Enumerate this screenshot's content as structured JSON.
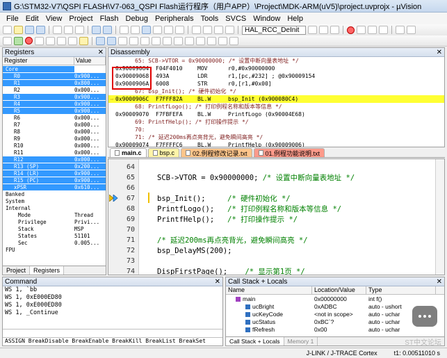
{
  "window": {
    "title": "G:\\STM32-V7\\QSPI FLASH\\V7-063_QSPI Flash运行程序（用户APP）\\Project\\MDK-ARM(uV5)\\project.uvprojx - µVision"
  },
  "menu": [
    "File",
    "Edit",
    "View",
    "Project",
    "Flash",
    "Debug",
    "Peripherals",
    "Tools",
    "SVCS",
    "Window",
    "Help"
  ],
  "toolbar": {
    "target_combo": "HAL_RCC_DeInit"
  },
  "registers": {
    "title": "Registers",
    "headers": [
      "Register",
      "Value"
    ],
    "rows": [
      {
        "name": "Core",
        "value": "",
        "sel": true
      },
      {
        "name": "R0",
        "value": "0x900...",
        "sel": true
      },
      {
        "name": "R1",
        "value": "0x800...",
        "sel": true
      },
      {
        "name": "R2",
        "value": "0x000...",
        "sel": false
      },
      {
        "name": "R3",
        "value": "0x900...",
        "sel": true
      },
      {
        "name": "R4",
        "value": "0x900...",
        "sel": true
      },
      {
        "name": "R5",
        "value": "0x900...",
        "sel": true
      },
      {
        "name": "R6",
        "value": "0x000...",
        "sel": false
      },
      {
        "name": "R7",
        "value": "0x000...",
        "sel": false
      },
      {
        "name": "R8",
        "value": "0x000...",
        "sel": false
      },
      {
        "name": "R9",
        "value": "0x000...",
        "sel": false
      },
      {
        "name": "R10",
        "value": "0x000...",
        "sel": false
      },
      {
        "name": "R11",
        "value": "0x000...",
        "sel": false
      },
      {
        "name": "R12",
        "value": "0x000...",
        "sel": true
      },
      {
        "name": "R13 (SP)",
        "value": "0x200...",
        "sel": true
      },
      {
        "name": "R14 (LR)",
        "value": "0x900...",
        "sel": true
      },
      {
        "name": "R15 (PC)",
        "value": "0x900...",
        "sel": true
      },
      {
        "name": "xPSR",
        "value": "0x610...",
        "sel": true
      },
      {
        "name": "Banked",
        "value": "",
        "sel": false
      },
      {
        "name": "System",
        "value": "",
        "sel": false
      },
      {
        "name": "Internal",
        "value": "",
        "sel": false
      },
      {
        "name": "Mode",
        "value": "Thread",
        "sel": false
      },
      {
        "name": "Privilege",
        "value": "Privi...",
        "sel": false
      },
      {
        "name": "Stack",
        "value": "MSP",
        "sel": false
      },
      {
        "name": "States",
        "value": "51101",
        "sel": false
      },
      {
        "name": "Sec",
        "value": "0.005...",
        "sel": false
      },
      {
        "name": "FPU",
        "value": "",
        "sel": false
      }
    ],
    "tabs": [
      "Project",
      "Registers"
    ]
  },
  "disassembly": {
    "title": "Disassembly",
    "lines": [
      {
        "kind": "src",
        "text": "65:          SCB->VTOR = 0x90000000;  /* 设置中断向量表地址 */"
      },
      {
        "kind": "asm",
        "addr": "0x90009064",
        "code": "F04F4010",
        "op": "MOV",
        "args": "r0,#0x90000000"
      },
      {
        "kind": "asm",
        "addr": "0x90009068",
        "code": "493A",
        "op": "LDR",
        "args": "r1,[pc,#232]  ; @0x90009154"
      },
      {
        "kind": "asm",
        "addr": "0x9000906A",
        "code": "6008",
        "op": "STR",
        "args": "r0,[r1,#0x00]"
      },
      {
        "kind": "src",
        "text": "67:      bsp_Init();          /* 硬件初始化 */"
      },
      {
        "kind": "cur",
        "addr": "0x9000906C",
        "code": "F7FFF82A",
        "op": "BL.W",
        "args": "bsp_Init (0x900080C4)"
      },
      {
        "kind": "src",
        "text": "68:      PrintfLogo();    /* 打印例程名称和版本等信息 */"
      },
      {
        "kind": "asm",
        "addr": "0x90009070",
        "code": "F7FBFEFA",
        "op": "BL.W",
        "args": "PrintfLogo (0x90004E68)"
      },
      {
        "kind": "src",
        "text": "69:      PrintfHelp();    /* 打印操作提示 */"
      },
      {
        "kind": "src",
        "text": "70:"
      },
      {
        "kind": "src",
        "text": "71:      /* 延迟200ms再点亮背光，避免瞬间高亮 */"
      },
      {
        "kind": "asm",
        "addr": "0x90009074",
        "code": "F7FFFFC6",
        "op": "BL.W",
        "args": "PrintfHelp (0x90009006)"
      }
    ]
  },
  "editor_tabs": [
    "main.c",
    "bsp.c",
    "02.例程修改记录.txt",
    "01.例程功能说明.txt"
  ],
  "editor": {
    "lines": [
      {
        "n": "64",
        "code": "",
        "comment": ""
      },
      {
        "n": "65",
        "code": "SCB->VTOR = 0x90000000; ",
        "comment": "/* 设置中断向量表地址 */"
      },
      {
        "n": "66",
        "code": "",
        "comment": ""
      },
      {
        "n": "67",
        "code": "bsp_Init();     ",
        "comment": "/* 硬件初始化 */"
      },
      {
        "n": "68",
        "code": "PrintfLogo();   ",
        "comment": "/* 打印例程名称和版本等信息 */"
      },
      {
        "n": "69",
        "code": "PrintfHelp();   ",
        "comment": "/* 打印操作提示 */"
      },
      {
        "n": "70",
        "code": "",
        "comment": ""
      },
      {
        "n": "71",
        "code": "",
        "comment": "/* 延迟200ms再点亮背光，避免瞬间高亮 */"
      },
      {
        "n": "72",
        "code": "bsp_DelayMS(200);",
        "comment": ""
      },
      {
        "n": "73",
        "code": "",
        "comment": ""
      },
      {
        "n": "74",
        "code": "DispFirstPage();    ",
        "comment": "/* 显示第1页 */"
      }
    ]
  },
  "command": {
    "title": "Command",
    "lines": [
      "WS 1, `bb",
      "WS 1, 0xE000ED80",
      "WS 1, 0xE000ED80",
      "WS 1, _Continue"
    ],
    "help": "ASSIGN BreakDisable BreakEnable BreakKill BreakList BreakSet"
  },
  "callstack": {
    "title": "Call Stack + Locals",
    "headers": [
      "Name",
      "Location/Value",
      "Type"
    ],
    "rows": [
      {
        "name": "main",
        "loc": "0x00000000",
        "type": "int f()"
      },
      {
        "name": "ucBright",
        "loc": "0xADBC",
        "type": "auto - ushort"
      },
      {
        "name": "ucKeyCode",
        "loc": "<not in scope>",
        "type": "auto - uchar"
      },
      {
        "name": "ucStatus",
        "loc": "0xBC`?",
        "type": "auto - uchar"
      },
      {
        "name": "fRefresh",
        "loc": "0x00",
        "type": "auto - uchar"
      }
    ],
    "tabs": [
      "Call Stack + Locals",
      "Memory 1"
    ]
  },
  "status": {
    "debugger": "J-LINK / J-TRACE Cortex",
    "time": "t1: 0.00511010 s"
  },
  "watermark": "ST中文论坛",
  "colors": {
    "selection": "#3399ff",
    "current_line": "#ffff33",
    "highlight_box": "#e00000"
  }
}
